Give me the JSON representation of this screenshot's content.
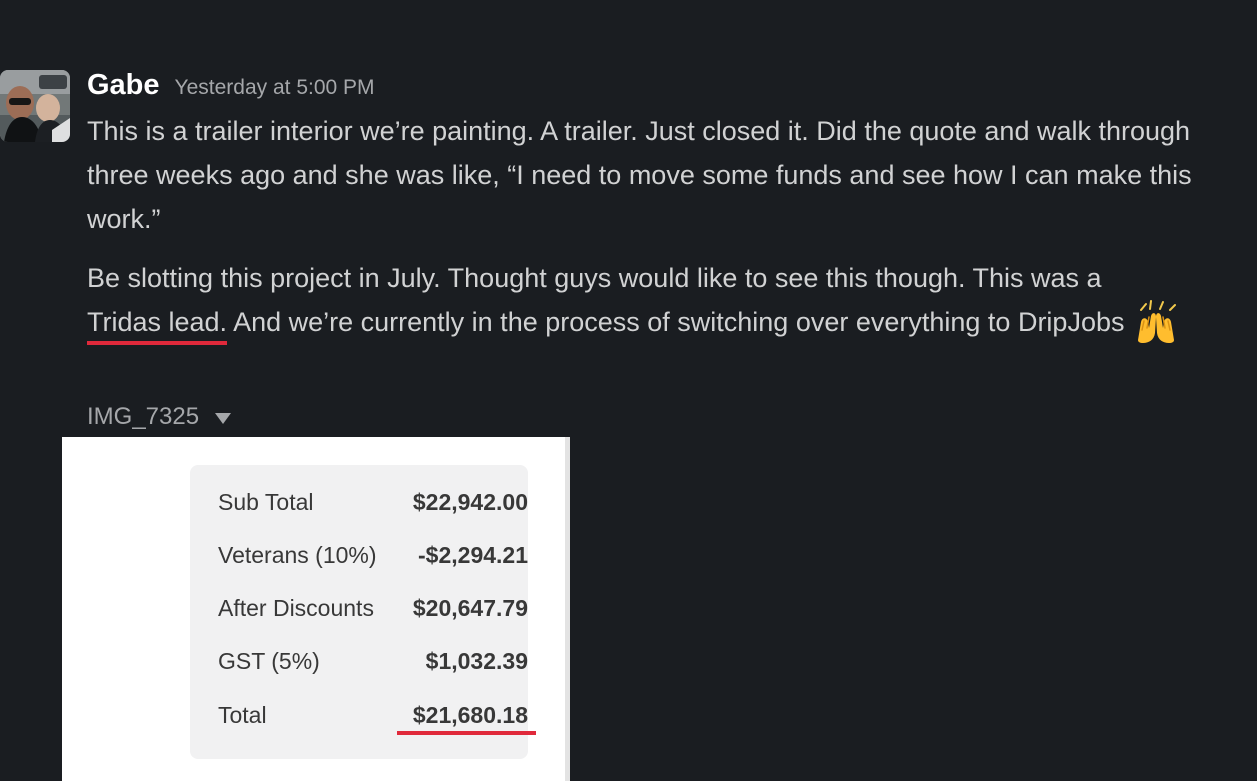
{
  "message": {
    "sender": "Gabe",
    "timestamp": "Yesterday at 5:00 PM",
    "paragraphs": {
      "p1": "This is a trailer interior we’re painting. A trailer. Just closed it. Did the quote and walk through three weeks ago and she was like, “I need to move some funds and see how I can make this work.”",
      "p2_before": "Be slotting this project in July. Thought guys would like to see this though. This was a ",
      "p2_highlight": "Tridas lead.",
      "p2_after": " And we’re currently in the process of switching over everything to DripJobs"
    },
    "emoji": "raised-hands-emoji"
  },
  "attachment": {
    "file_name": "IMG_7325",
    "caret_icon": "chevron-down-icon",
    "receipt": {
      "rows": [
        {
          "label": "Sub Total",
          "value": "$22,942.00"
        },
        {
          "label": "Veterans (10%)",
          "value": "-$2,294.21"
        },
        {
          "label": "After Discounts",
          "value": "$20,647.79"
        },
        {
          "label": "GST (5%)",
          "value": "$1,032.39"
        },
        {
          "label": "Total",
          "value": "$21,680.18"
        }
      ]
    }
  },
  "colors": {
    "background": "#1a1d21",
    "primary_text": "#d1d2d3",
    "muted_text": "#a5a7aa",
    "sender_text": "#ffffff",
    "highlight_underline": "#e0293b"
  }
}
